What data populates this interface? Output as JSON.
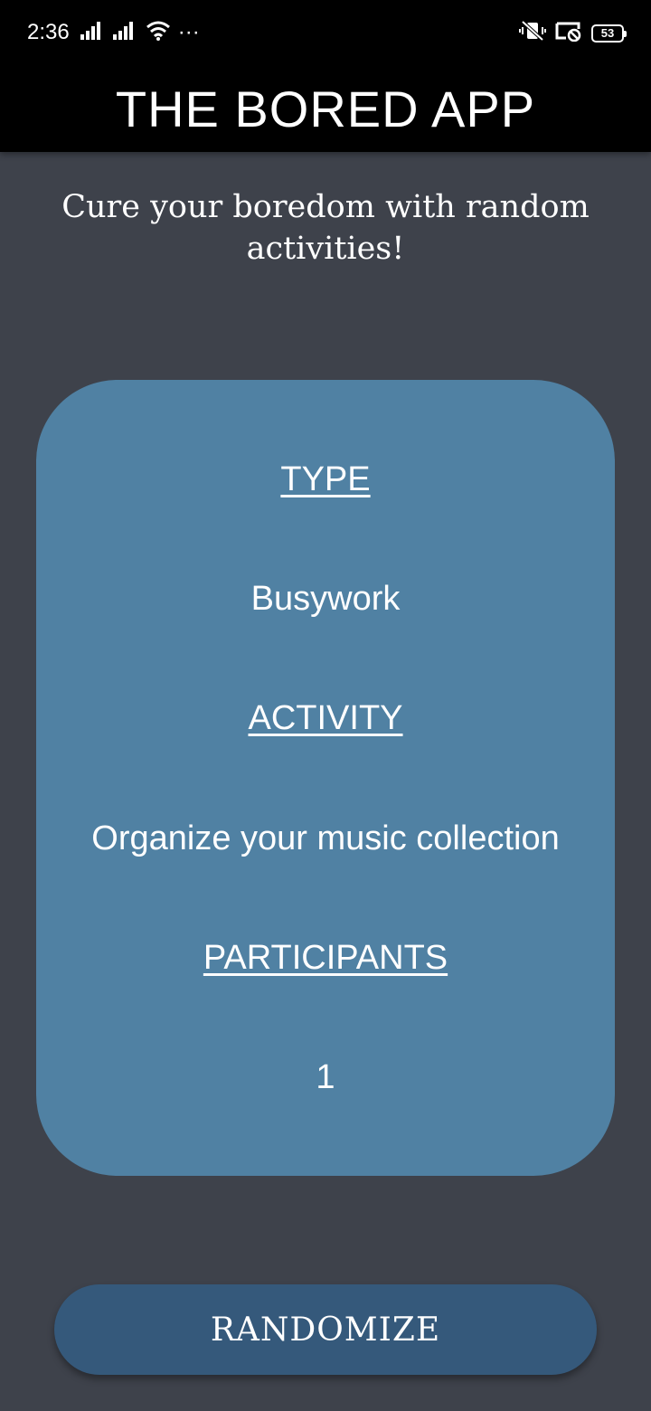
{
  "status_bar": {
    "time": "2:36",
    "more_indicator": "···",
    "battery_level": "53",
    "icons": [
      "signal-icon",
      "signal-icon",
      "wifi-icon",
      "vibrate-off-icon",
      "cast-off-icon",
      "battery-icon"
    ]
  },
  "app_bar": {
    "title": "THE BORED APP"
  },
  "tagline": "Cure your boredom with random activities!",
  "card": {
    "type_heading": "TYPE",
    "type_value": "Busywork",
    "activity_heading": "ACTIVITY",
    "activity_value": "Organize your music collection",
    "participants_heading": "PARTICIPANTS",
    "participants_value": "1"
  },
  "randomize_button": {
    "label": "RANDOMIZE"
  },
  "colors": {
    "background": "#3e424b",
    "app_bar": "#000000",
    "card": "#5081a3",
    "button": "#35597b",
    "text": "#ffffff"
  }
}
